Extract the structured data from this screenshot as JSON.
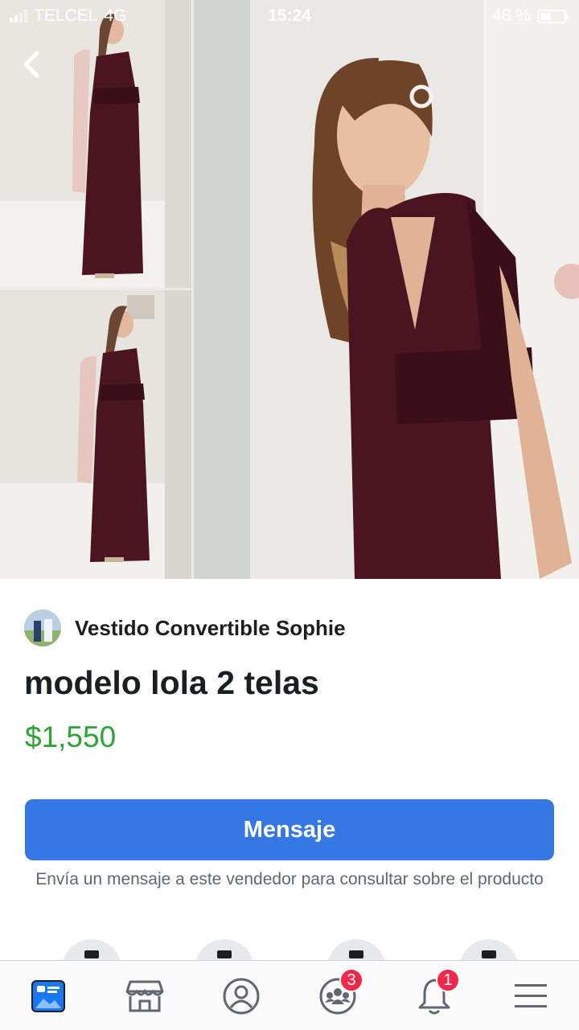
{
  "status_bar": {
    "carrier": "TELCEL",
    "network": "4G",
    "time": "15:24",
    "battery_text": "48 %",
    "battery_level": 0.48
  },
  "listing": {
    "seller_name": "Vestido Convertible Sophie",
    "title": "modelo lola 2 telas",
    "price": "$1,550",
    "message_button": "Mensaje",
    "helper_text": "Envía un mensaje a este vendedor para consultar sobre el producto"
  },
  "tab_bar": {
    "items": [
      {
        "icon": "news-feed-icon",
        "active": true
      },
      {
        "icon": "marketplace-icon"
      },
      {
        "icon": "profile-icon"
      },
      {
        "icon": "groups-icon",
        "badge": "3"
      },
      {
        "icon": "notifications-bell-icon",
        "badge": "1"
      },
      {
        "icon": "menu-icon"
      }
    ]
  },
  "colors": {
    "accent": "#3578e5",
    "price": "#2ea336",
    "badge": "#f02849",
    "dress": "#4a1420"
  }
}
